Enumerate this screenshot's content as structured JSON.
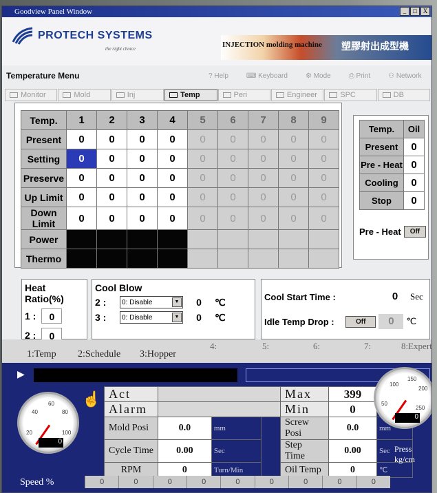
{
  "window": {
    "title": "Goodview Panel Window",
    "controls": [
      "_",
      "□",
      "X"
    ]
  },
  "brand": {
    "logo_text": "PROTECH SYSTEMS",
    "logo_tagline": "the right choice",
    "banner_left": "INJECTION molding machine",
    "banner_right": "塑膠射出成型機"
  },
  "menu_title": "Temperature Menu",
  "toolbar": {
    "help": "Help",
    "keyboard": "Keyboard",
    "mode": "Mode",
    "print": "Print",
    "network": "Network"
  },
  "tabs": [
    {
      "label": "Monitor",
      "active": false
    },
    {
      "label": "Mold",
      "active": false
    },
    {
      "label": "Inj",
      "active": false
    },
    {
      "label": "Temp",
      "active": true
    },
    {
      "label": "Peri",
      "active": false
    },
    {
      "label": "Engineer",
      "active": false
    },
    {
      "label": "SPC",
      "active": false
    },
    {
      "label": "DB",
      "active": false
    }
  ],
  "temp_table": {
    "header_label": "Temp.",
    "zones": [
      "1",
      "2",
      "3",
      "4",
      "5",
      "6",
      "7",
      "8",
      "9"
    ],
    "rows": [
      {
        "label": "Present",
        "values": [
          "0",
          "0",
          "0",
          "0",
          "0",
          "0",
          "0",
          "0",
          "0"
        ]
      },
      {
        "label": "Setting",
        "values": [
          "0",
          "0",
          "0",
          "0",
          "0",
          "0",
          "0",
          "0",
          "0"
        ]
      },
      {
        "label": "Preserve",
        "values": [
          "0",
          "0",
          "0",
          "0",
          "0",
          "0",
          "0",
          "0",
          "0"
        ]
      },
      {
        "label": "Up Limit",
        "values": [
          "0",
          "0",
          "0",
          "0",
          "0",
          "0",
          "0",
          "0",
          "0"
        ]
      },
      {
        "label": "Down Limit",
        "values": [
          "0",
          "0",
          "0",
          "0",
          "0",
          "0",
          "0",
          "0",
          "0"
        ]
      }
    ],
    "power_label": "Power",
    "thermo_label": "Thermo"
  },
  "oil": {
    "header_label": "Temp.",
    "header_value": "Oil",
    "rows": [
      {
        "label": "Present",
        "value": "0"
      },
      {
        "label": "Pre - Heat",
        "value": "0"
      },
      {
        "label": "Cooling",
        "value": "0"
      },
      {
        "label": "Stop",
        "value": "0"
      }
    ],
    "preheat_label": "Pre - Heat",
    "preheat_button": "Off"
  },
  "heat_ratio": {
    "title": "Heat Ratio(%)",
    "rows": [
      {
        "label": "1 :",
        "value": "0"
      },
      {
        "label": "2 :",
        "value": "0"
      }
    ]
  },
  "cool_blow": {
    "title": "Cool Blow",
    "unit": "℃",
    "rows": [
      {
        "label": "2 :",
        "option": "0: Disable",
        "value": "0"
      },
      {
        "label": "3 :",
        "option": "0: Disable",
        "value": "0"
      }
    ]
  },
  "cool_start": {
    "label": "Cool Start Time :",
    "value": "0",
    "unit": "Sec",
    "idle_label": "Idle Temp Drop :",
    "idle_button": "Off",
    "idle_value": "0",
    "idle_unit": "℃"
  },
  "page_tabs": [
    "1:Temp",
    "2:Schedule",
    "3:Hopper",
    "4:",
    "5:",
    "6:",
    "7:",
    "8:Expert"
  ],
  "status": {
    "act_label": "Act",
    "alarm_label": "Alarm",
    "max_label": "Max",
    "max_value": "399",
    "max_unit": "℃",
    "min_label": "Min",
    "min_value": "0",
    "min_unit": "℃",
    "mold_posi": {
      "label": "Mold Posi",
      "value": "0.0",
      "unit": "mm"
    },
    "cycle_time": {
      "label": "Cycle Time",
      "value": "0.00",
      "unit": "Sec"
    },
    "rpm": {
      "label": "RPM",
      "value": "0",
      "unit": "Turn/Min"
    },
    "screw_posi": {
      "label": "Screw Posi",
      "value": "0.0",
      "unit": "mm"
    },
    "step_time": {
      "label": "Step Time",
      "value": "0.00",
      "unit": "Sec"
    },
    "oil_temp": {
      "label": "Oil Temp",
      "value": "0",
      "unit": "℃"
    },
    "footer_values": [
      "0",
      "0",
      "0",
      "0",
      "0",
      "0",
      "0",
      "0",
      "0"
    ]
  },
  "gauges": {
    "speed": {
      "label": "Speed  %",
      "value": "0",
      "ticks": [
        "20",
        "40",
        "60",
        "80",
        "100"
      ],
      "level": 0
    },
    "press": {
      "label": "Press  kg/cm",
      "value": "0",
      "ticks": [
        "50",
        "100",
        "150",
        "200",
        "250"
      ],
      "level": 0
    }
  },
  "colors": {
    "selected_cell": "#2b3bb8",
    "bottom_panel": "#1b2676",
    "header_cell": "#bdbdbd"
  }
}
